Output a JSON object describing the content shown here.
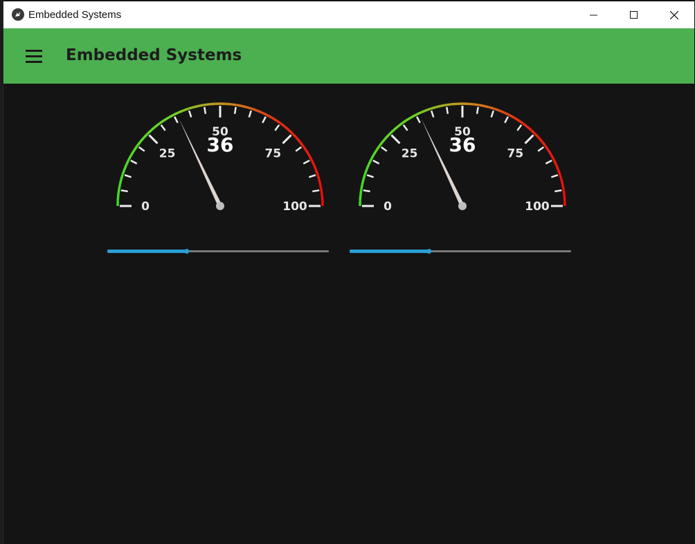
{
  "window": {
    "title": "Embedded Systems",
    "icon": "kivy-logo-icon"
  },
  "window_controls": [
    "minimize-icon",
    "maximize-icon",
    "close-icon"
  ],
  "appbar": {
    "title": "Embedded Systems",
    "menu_icon": "hamburger-menu-icon",
    "color": "#4caf50"
  },
  "gauges": [
    {
      "value": 36,
      "value_label": "36",
      "min": 0,
      "max": 100,
      "labels": [
        "0",
        "25",
        "50",
        "75",
        "100"
      ]
    },
    {
      "value": 36,
      "value_label": "36",
      "min": 0,
      "max": 100,
      "labels": [
        "0",
        "25",
        "50",
        "75",
        "100"
      ]
    }
  ],
  "sliders": [
    {
      "value": 36,
      "min": 0,
      "max": 100,
      "color": "#2a9fd6"
    },
    {
      "value": 36,
      "min": 0,
      "max": 100,
      "color": "#2a9fd6"
    }
  ]
}
